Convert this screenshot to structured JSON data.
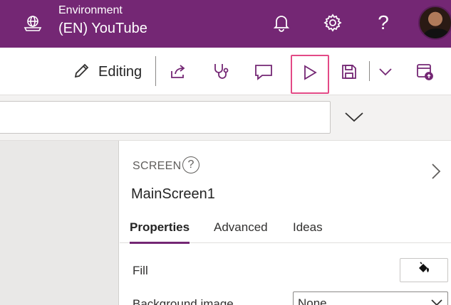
{
  "header": {
    "environment_label": "Environment",
    "environment_name": "(EN) YouTube",
    "icons": [
      "environment-icon",
      "bell-icon",
      "gear-icon",
      "help-icon",
      "avatar"
    ],
    "help_glyph": "?",
    "background_color": "#742774"
  },
  "commandbar": {
    "editing_label": "Editing",
    "icons": [
      "pencil-icon",
      "share-icon",
      "stethoscope-icon",
      "comment-icon",
      "play-icon",
      "save-icon",
      "chevron-down-icon",
      "publish-icon"
    ],
    "highlight_color": "#e34a86"
  },
  "formula": {
    "value": "",
    "icons": [
      "chevron-down-icon"
    ]
  },
  "pane": {
    "screen_type": "SCREEN",
    "help_glyph": "?",
    "screen_name": "MainScreen1",
    "tabs": [
      {
        "label": "Properties",
        "active": true
      },
      {
        "label": "Advanced",
        "active": false
      },
      {
        "label": "Ideas",
        "active": false
      }
    ],
    "properties": {
      "fill_label": "Fill",
      "background_image_label": "Background image",
      "background_image_value": "None"
    },
    "accent_color": "#742774"
  }
}
